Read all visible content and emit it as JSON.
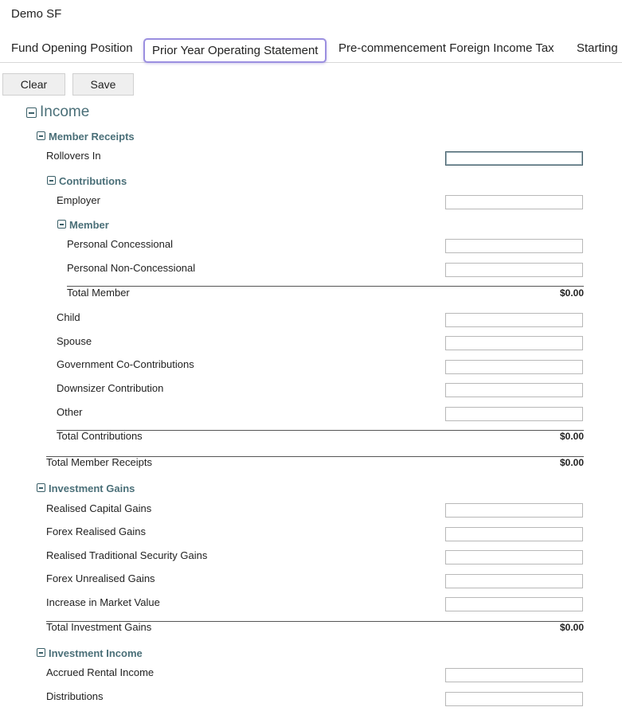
{
  "app_title": "Demo SF",
  "tabs": [
    {
      "label": "Fund Opening Position"
    },
    {
      "label": "Prior Year Operating Statement"
    },
    {
      "label": "Pre-commencement Foreign Income Tax"
    },
    {
      "label": "Starting"
    }
  ],
  "toolbar": {
    "clear_label": "Clear",
    "save_label": "Save"
  },
  "income": {
    "title": "Income",
    "member_receipts": {
      "title": "Member Receipts",
      "rollovers_in": "Rollovers In",
      "contributions": {
        "title": "Contributions",
        "employer": "Employer",
        "member": {
          "title": "Member",
          "personal_concessional": "Personal Concessional",
          "personal_non_concessional": "Personal Non-Concessional",
          "total_label": "Total Member",
          "total_value": "$0.00"
        },
        "child": "Child",
        "spouse": "Spouse",
        "govt_co_contributions": "Government Co-Contributions",
        "downsizer": "Downsizer Contribution",
        "other": "Other",
        "total_label": "Total Contributions",
        "total_value": "$0.00"
      },
      "total_label": "Total Member Receipts",
      "total_value": "$0.00"
    },
    "investment_gains": {
      "title": "Investment Gains",
      "realised_capital_gains": "Realised Capital Gains",
      "forex_realised_gains": "Forex Realised Gains",
      "realised_traditional": "Realised Traditional Security Gains",
      "forex_unrealised_gains": "Forex Unrealised Gains",
      "increase_market_value": "Increase in Market Value",
      "total_label": "Total Investment Gains",
      "total_value": "$0.00"
    },
    "investment_income": {
      "title": "Investment Income",
      "accrued_rental_income": "Accrued Rental Income",
      "distributions": "Distributions"
    }
  }
}
